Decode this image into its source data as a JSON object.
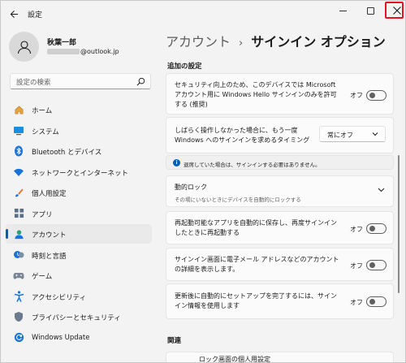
{
  "window": {
    "app_title": "設定",
    "controls": {
      "minimize": "—",
      "maximize": "☐",
      "close": "✕"
    }
  },
  "profile": {
    "name": "秋葉一郎",
    "email_domain": "@outlook.jp"
  },
  "search": {
    "placeholder": "設定の検索"
  },
  "nav": {
    "items": [
      {
        "label": "ホーム",
        "icon": "home-icon"
      },
      {
        "label": "システム",
        "icon": "system-icon"
      },
      {
        "label": "Bluetooth とデバイス",
        "icon": "bluetooth-icon"
      },
      {
        "label": "ネットワークとインターネット",
        "icon": "network-icon"
      },
      {
        "label": "個人用設定",
        "icon": "personalization-icon"
      },
      {
        "label": "アプリ",
        "icon": "apps-icon"
      },
      {
        "label": "アカウント",
        "icon": "accounts-icon",
        "active": true
      },
      {
        "label": "時刻と言語",
        "icon": "time-language-icon"
      },
      {
        "label": "ゲーム",
        "icon": "gaming-icon"
      },
      {
        "label": "アクセシビリティ",
        "icon": "accessibility-icon"
      },
      {
        "label": "プライバシーとセキュリティ",
        "icon": "privacy-icon"
      },
      {
        "label": "Windows Update",
        "icon": "windows-update-icon"
      }
    ]
  },
  "header": {
    "parent": "アカウント",
    "separator": "›",
    "current": "サインイン オプション"
  },
  "main": {
    "section_additional": "追加の設定",
    "section_related": "関連",
    "related_partial": "ロック画面の個人用設定",
    "cards": {
      "hello_only": {
        "text": "セキュリティ向上のため、このデバイスでは Microsoft アカウント用に Windows Hello サインインのみを許可する (推奨)",
        "toggle_label": "オフ"
      },
      "require_signin": {
        "text": "しばらく操作しなかった場合に、もう一度 Windows へのサインインを求めるタイミング",
        "dropdown_value": "常にオフ"
      },
      "info": {
        "icon": "i",
        "text": "退席していた場合は、サインインする必要はありません。"
      },
      "dynamic_lock": {
        "title": "動的ロック",
        "subtitle": "その場にいないときにデバイスを自動的にロックする"
      },
      "restart_apps": {
        "text": "再起動可能なアプリを自動的に保存し、再度サインインしたときに再起動する",
        "toggle_label": "オフ"
      },
      "show_account": {
        "text": "サインイン画面に電子メール アドレスなどのアカウントの詳細を表示します。",
        "toggle_label": "オフ"
      },
      "finish_setup": {
        "text": "更新後に自動的にセットアップを完了するには、サインイン情報を使用します",
        "toggle_label": "オフ"
      }
    }
  },
  "colors": {
    "accent": "#005fb8",
    "close_highlight": "#e81123",
    "window_bg": "#f3f3f3",
    "card_bg": "#fbfbfb"
  }
}
